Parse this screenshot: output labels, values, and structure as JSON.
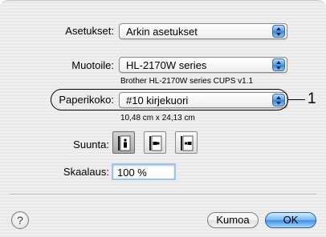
{
  "settings": {
    "label": "Asetukset:",
    "value": "Arkin asetukset"
  },
  "printer": {
    "label": "Muotoile:",
    "value": "HL-2170W series",
    "description": "Brother HL-2170W series CUPS v1.1"
  },
  "paper": {
    "label": "Paperikoko:",
    "value": "#10 kirjekuori",
    "dimensions": "10,48 cm x 24,13 cm"
  },
  "orientation": {
    "label": "Suunta:",
    "options": [
      "portrait",
      "landscape",
      "reverse-landscape"
    ],
    "selected": "portrait"
  },
  "scale": {
    "label": "Skaalaus:",
    "value": "100 %"
  },
  "buttons": {
    "help": "?",
    "cancel": "Kumoa",
    "ok": "OK"
  },
  "callout": {
    "number": "1"
  }
}
